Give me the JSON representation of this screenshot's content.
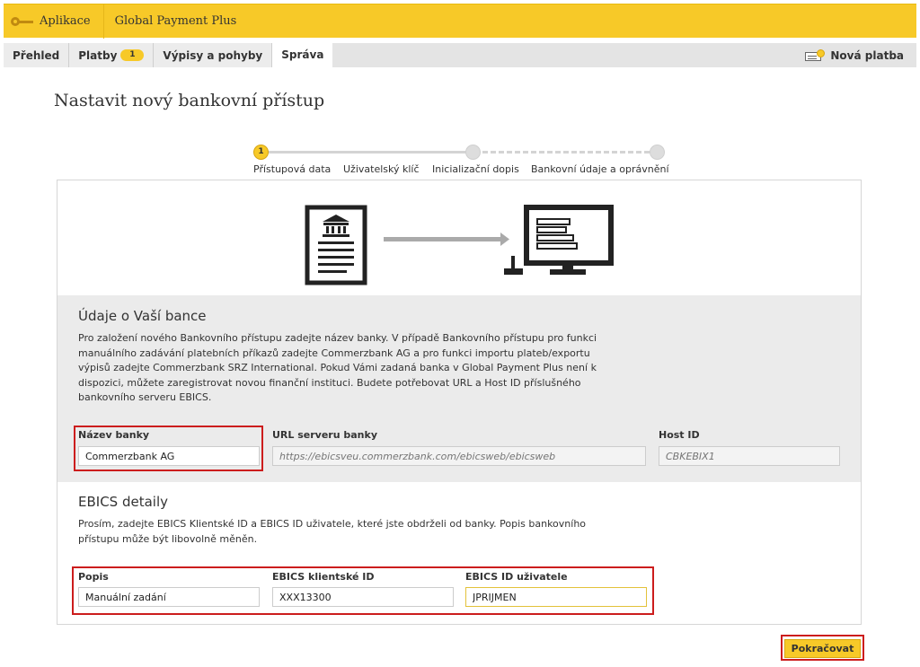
{
  "topbar": {
    "app_label": "Aplikace",
    "product_name": "Global Payment Plus",
    "accent_color": "#f7c928"
  },
  "tabs": [
    {
      "label": "Přehled"
    },
    {
      "label": "Platby",
      "badge": "1"
    },
    {
      "label": "Výpisy a pohyby"
    },
    {
      "label": "Správa",
      "active": true
    }
  ],
  "new_payment_label": "Nová platba",
  "page_title": "Nastavit nový bankovní přístup",
  "steps": [
    {
      "number": "1",
      "label": "Přístupová data",
      "current": true
    },
    {
      "label": "Uživatelský klíč"
    },
    {
      "label": "Inicializační dopis"
    },
    {
      "label": "Bankovní údaje a oprávnění"
    }
  ],
  "bank_section": {
    "title": "Údaje o Vaší bance",
    "text_lines": [
      "Pro založení nového Bankovního přístupu zadejte název banky. V případě Bankovního přístupu pro funkci",
      "manuálního zadávání platebních příkazů zadejte Commerzbank AG a pro funkci importu plateb/exportu",
      "výpisů zadejte Commerzbank SRZ International. Pokud Vámi zadaná banka v Global Payment Plus není k",
      "dispozici, můžete zaregistrovat novou finanční instituci. Budete potřebovat URL a Host ID příslušného",
      "bankovního serveru EBICS."
    ],
    "fields": {
      "bank_name": {
        "label": "Název banky",
        "value": "Commerzbank AG"
      },
      "server_url": {
        "label": "URL serveru banky",
        "placeholder": "https://ebicsveu.commerzbank.com/ebicsweb/ebicsweb"
      },
      "host_id": {
        "label": "Host ID",
        "placeholder": "CBKEBIX1"
      }
    }
  },
  "ebics_section": {
    "title": "EBICS detaily",
    "text_lines": [
      "Prosím, zadejte EBICS Klientské ID a EBICS ID uživatele, které jste obdrželi od banky. Popis bankovního",
      "přístupu může být libovolně měněn."
    ],
    "fields": {
      "description": {
        "label": "Popis",
        "value": "Manuální zadání"
      },
      "client_id": {
        "label": "EBICS klientské ID",
        "value": "XXX13300"
      },
      "user_id": {
        "label": "EBICS ID uživatele",
        "value": "JPRIJMEN"
      }
    }
  },
  "continue_button": "Pokračovat",
  "highlight_color": "#cc1d1d"
}
